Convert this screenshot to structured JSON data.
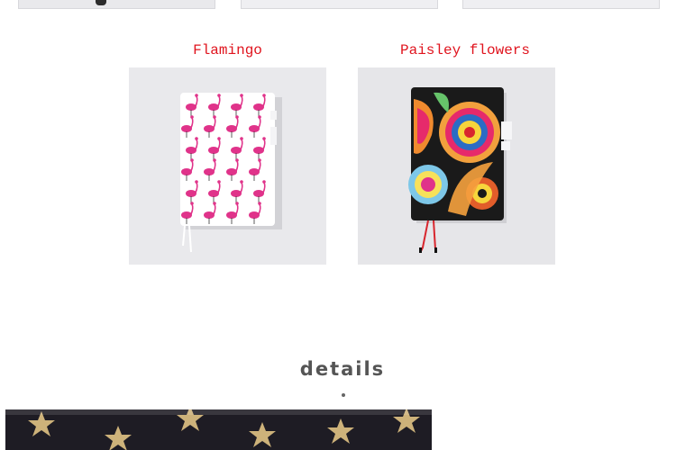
{
  "products": [
    {
      "caption": "Flamingo"
    },
    {
      "caption": "Paisley flowers"
    }
  ],
  "details": {
    "title": "details"
  },
  "colors": {
    "caption": "#e0141e",
    "heading": "#555555"
  }
}
